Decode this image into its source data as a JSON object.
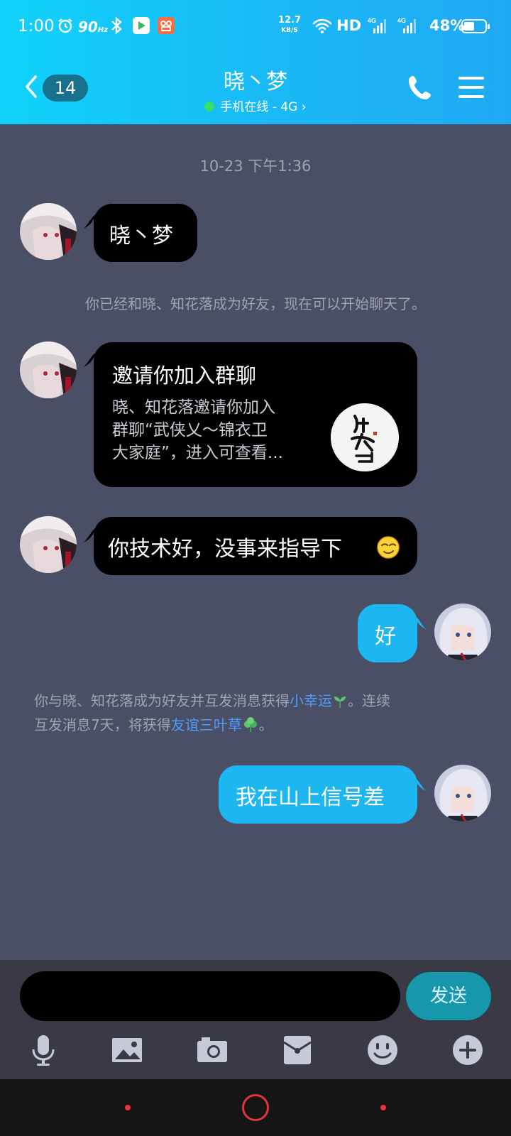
{
  "status_bar": {
    "time": "1:00",
    "refresh_rate": "90",
    "refresh_unit": "Hz",
    "net_speed_value": "12.7",
    "net_speed_unit": "KB/S",
    "hd_label": "HD",
    "network_1": "4G",
    "network_2": "4G",
    "battery_pct": "48%",
    "battery_level": 0.48
  },
  "header": {
    "back_count": "14",
    "contact_name": "晓丶梦",
    "online_status": "手机在线 - 4G",
    "status_chevron": "›",
    "icons": [
      "back-icon",
      "phone-icon",
      "menu-icon"
    ]
  },
  "chat": {
    "timestamp": "10-23 下午1:36",
    "msg1": "晓丶梦",
    "system_friend": "你已经和晓、知花落成为好友，现在可以开始聊天了。",
    "card": {
      "title": "邀请你加入群聊",
      "desc_line1": "晓、知花落邀请你加入",
      "desc_line2": "群聊“武侠乂～锦衣卫",
      "desc_line3": "大家庭”，进入可查看...",
      "logo_text": "锦衣卫"
    },
    "msg3": "你技术好，没事来指导下",
    "reply1": "好",
    "system_luck": {
      "part1": "你与晓、知花落成为好友并互发消息获得",
      "link1": "小幸运",
      "part2": "。连续",
      "part3": "互发消息7天，将获得",
      "link2": "友谊三叶草",
      "part4": "。"
    },
    "reply2": "我在山上信号差"
  },
  "composer": {
    "input_value": "",
    "send_label": "发送",
    "tools": [
      "microphone-icon",
      "image-icon",
      "camera-icon",
      "red-packet-icon",
      "emoji-icon",
      "plus-icon"
    ]
  },
  "colors": {
    "header_gradient_start": "#0fd3fb",
    "header_gradient_end": "#1fa9f3",
    "chat_background": "#4a4f66",
    "incoming_bubble": "#000000",
    "outgoing_bubble": "#1cb7f0",
    "link": "#4e9cff",
    "send_button": "#1697ab"
  }
}
